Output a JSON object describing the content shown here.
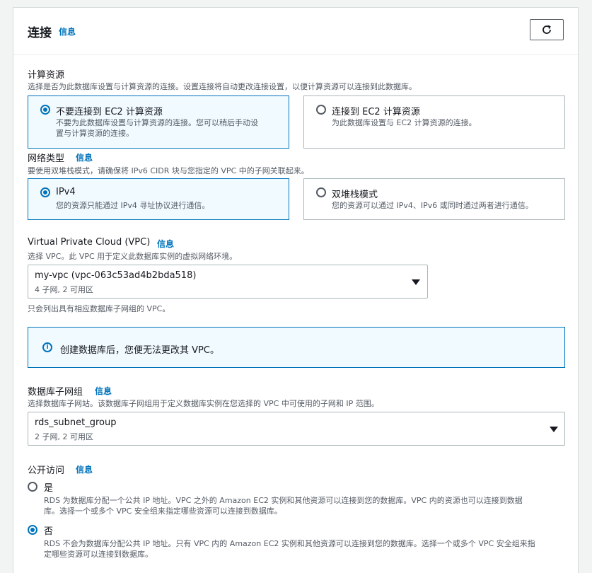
{
  "header": {
    "title": "连接",
    "info": "信息"
  },
  "compute": {
    "label": "计算资源",
    "desc": "选择是否为此数据库设置与计算资源的连接。设置连接将自动更改连接设置，以便计算资源可以连接到此数据库。",
    "options": [
      {
        "title": "不要连接到 EC2 计算资源",
        "desc_line1": "不要为此数据库设置与计算资源的连接。您可以稍后手动设",
        "desc_line2": "置与计算资源的连接。",
        "selected": true
      },
      {
        "title": "连接到 EC2 计算资源",
        "desc_line1": "为此数据库设置与 EC2 计算资源的连接。",
        "desc_line2": "",
        "selected": false
      }
    ]
  },
  "network": {
    "label": "网络类型",
    "info": "信息",
    "desc": "要使用双堆栈模式，请确保将 IPv6 CIDR 块与您指定的 VPC 中的子网关联起来。",
    "options": [
      {
        "title": "IPv4",
        "desc": "您的资源只能通过 IPv4 寻址协议进行通信。",
        "selected": true
      },
      {
        "title": "双堆栈模式",
        "desc": "您的资源可以通过 IPv4、IPv6 或同时通过两者进行通信。",
        "selected": false
      }
    ]
  },
  "vpc": {
    "label": "Virtual Private Cloud (VPC)",
    "info": "信息",
    "desc": "选择 VPC。此 VPC 用于定义此数据库实例的虚拟网络环境。",
    "value": "my-vpc (vpc-063c53ad4b2bda518)",
    "sub": "4 子网, 2 可用区",
    "hint": "只会列出具有相应数据库子网组的 VPC。"
  },
  "alert": {
    "text": "创建数据库后，您便无法更改其 VPC。",
    "icon": "info-icon"
  },
  "subnet": {
    "label": "数据库子网组",
    "info": "信息",
    "desc": "选择数据库子网站。该数据库子网组用于定义数据库实例在您选择的 VPC 中可使用的子网和 IP 范围。",
    "value": "rds_subnet_group",
    "sub": "2 子网, 2 可用区"
  },
  "public": {
    "label": "公开访问",
    "info": "信息",
    "options": [
      {
        "title": "是",
        "desc_line1": "RDS 为数据库分配一个公共 IP 地址。VPC 之外的 Amazon EC2 实例和其他资源可以连接到您的数据库。VPC 内的资源也可以连接到数据",
        "desc_line2": "库。选择一个或多个 VPC 安全组来指定哪些资源可以连接到数据库。",
        "selected": false
      },
      {
        "title": "否",
        "desc_line1": "RDS 不会为数据库分配公共 IP 地址。只有 VPC 内的 Amazon EC2 实例和其他资源可以连接到您的数据库。选择一个或多个 VPC 安全组来指",
        "desc_line2": "定哪些资源可以连接到数据库。",
        "selected": true
      }
    ]
  },
  "colors": {
    "accent": "#0073bb",
    "border": "#aab7b8",
    "selected_bg": "#f1faff"
  }
}
